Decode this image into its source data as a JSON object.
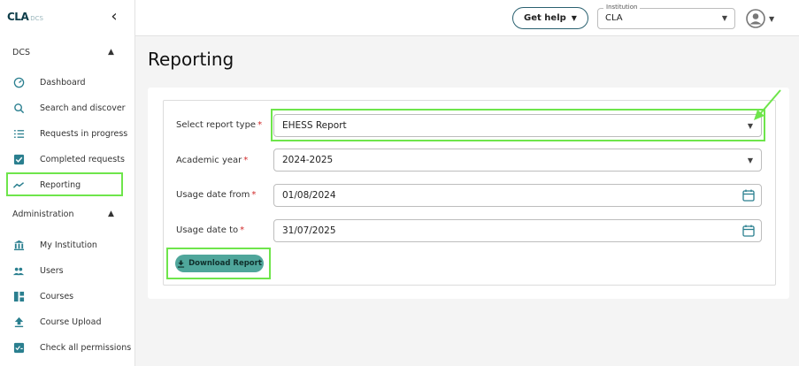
{
  "brand": {
    "logo_main": "CLA",
    "logo_sub": "DCS",
    "collapse_icon": "‹"
  },
  "sidebar": {
    "sections": [
      {
        "label": "DCS",
        "expanded": true
      },
      {
        "label": "Administration",
        "expanded": true
      }
    ],
    "dcs_items": [
      {
        "label": "Dashboard",
        "icon": "gauge-icon"
      },
      {
        "label": "Search and discover",
        "icon": "search-icon"
      },
      {
        "label": "Requests in progress",
        "icon": "list-icon"
      },
      {
        "label": "Completed requests",
        "icon": "checkbox-icon"
      },
      {
        "label": "Reporting",
        "icon": "trend-icon",
        "active": true
      }
    ],
    "admin_items": [
      {
        "label": "My Institution",
        "icon": "institution-icon"
      },
      {
        "label": "Users",
        "icon": "users-icon"
      },
      {
        "label": "Courses",
        "icon": "courses-icon"
      },
      {
        "label": "Course Upload",
        "icon": "upload-icon"
      },
      {
        "label": "Check all permissions",
        "icon": "permissions-icon"
      }
    ]
  },
  "topbar": {
    "get_help": "Get help",
    "institution_legend": "Institution",
    "institution_value": "CLA"
  },
  "page": {
    "title": "Reporting"
  },
  "form": {
    "report_type": {
      "label": "Select report type",
      "required": "*",
      "value": "EHESS Report"
    },
    "academic_year": {
      "label": "Academic year",
      "required": "*",
      "value": "2024-2025"
    },
    "usage_from": {
      "label": "Usage date from",
      "required": "*",
      "value": "01/08/2024"
    },
    "usage_to": {
      "label": "Usage date to",
      "required": "*",
      "value": "31/07/2025"
    },
    "download_label": "Download Report"
  },
  "colors": {
    "accent": "#4fa69b",
    "highlight": "#6ee54b",
    "brand_dark": "#0f3e4a",
    "required": "#d12b2b"
  }
}
